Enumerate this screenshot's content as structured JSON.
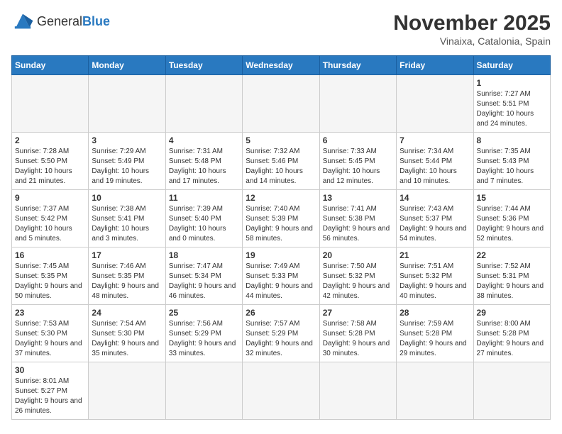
{
  "header": {
    "logo_general": "General",
    "logo_blue": "Blue",
    "title": "November 2025",
    "location": "Vinaixa, Catalonia, Spain"
  },
  "days_of_week": [
    "Sunday",
    "Monday",
    "Tuesday",
    "Wednesday",
    "Thursday",
    "Friday",
    "Saturday"
  ],
  "weeks": [
    [
      {
        "day": "",
        "info": "",
        "empty": true
      },
      {
        "day": "",
        "info": "",
        "empty": true
      },
      {
        "day": "",
        "info": "",
        "empty": true
      },
      {
        "day": "",
        "info": "",
        "empty": true
      },
      {
        "day": "",
        "info": "",
        "empty": true
      },
      {
        "day": "",
        "info": "",
        "empty": true
      },
      {
        "day": "1",
        "info": "Sunrise: 7:27 AM\nSunset: 5:51 PM\nDaylight: 10 hours and 24 minutes."
      }
    ],
    [
      {
        "day": "2",
        "info": "Sunrise: 7:28 AM\nSunset: 5:50 PM\nDaylight: 10 hours and 21 minutes."
      },
      {
        "day": "3",
        "info": "Sunrise: 7:29 AM\nSunset: 5:49 PM\nDaylight: 10 hours and 19 minutes."
      },
      {
        "day": "4",
        "info": "Sunrise: 7:31 AM\nSunset: 5:48 PM\nDaylight: 10 hours and 17 minutes."
      },
      {
        "day": "5",
        "info": "Sunrise: 7:32 AM\nSunset: 5:46 PM\nDaylight: 10 hours and 14 minutes."
      },
      {
        "day": "6",
        "info": "Sunrise: 7:33 AM\nSunset: 5:45 PM\nDaylight: 10 hours and 12 minutes."
      },
      {
        "day": "7",
        "info": "Sunrise: 7:34 AM\nSunset: 5:44 PM\nDaylight: 10 hours and 10 minutes."
      },
      {
        "day": "8",
        "info": "Sunrise: 7:35 AM\nSunset: 5:43 PM\nDaylight: 10 hours and 7 minutes."
      }
    ],
    [
      {
        "day": "9",
        "info": "Sunrise: 7:37 AM\nSunset: 5:42 PM\nDaylight: 10 hours and 5 minutes."
      },
      {
        "day": "10",
        "info": "Sunrise: 7:38 AM\nSunset: 5:41 PM\nDaylight: 10 hours and 3 minutes."
      },
      {
        "day": "11",
        "info": "Sunrise: 7:39 AM\nSunset: 5:40 PM\nDaylight: 10 hours and 0 minutes."
      },
      {
        "day": "12",
        "info": "Sunrise: 7:40 AM\nSunset: 5:39 PM\nDaylight: 9 hours and 58 minutes."
      },
      {
        "day": "13",
        "info": "Sunrise: 7:41 AM\nSunset: 5:38 PM\nDaylight: 9 hours and 56 minutes."
      },
      {
        "day": "14",
        "info": "Sunrise: 7:43 AM\nSunset: 5:37 PM\nDaylight: 9 hours and 54 minutes."
      },
      {
        "day": "15",
        "info": "Sunrise: 7:44 AM\nSunset: 5:36 PM\nDaylight: 9 hours and 52 minutes."
      }
    ],
    [
      {
        "day": "16",
        "info": "Sunrise: 7:45 AM\nSunset: 5:35 PM\nDaylight: 9 hours and 50 minutes."
      },
      {
        "day": "17",
        "info": "Sunrise: 7:46 AM\nSunset: 5:35 PM\nDaylight: 9 hours and 48 minutes."
      },
      {
        "day": "18",
        "info": "Sunrise: 7:47 AM\nSunset: 5:34 PM\nDaylight: 9 hours and 46 minutes."
      },
      {
        "day": "19",
        "info": "Sunrise: 7:49 AM\nSunset: 5:33 PM\nDaylight: 9 hours and 44 minutes."
      },
      {
        "day": "20",
        "info": "Sunrise: 7:50 AM\nSunset: 5:32 PM\nDaylight: 9 hours and 42 minutes."
      },
      {
        "day": "21",
        "info": "Sunrise: 7:51 AM\nSunset: 5:32 PM\nDaylight: 9 hours and 40 minutes."
      },
      {
        "day": "22",
        "info": "Sunrise: 7:52 AM\nSunset: 5:31 PM\nDaylight: 9 hours and 38 minutes."
      }
    ],
    [
      {
        "day": "23",
        "info": "Sunrise: 7:53 AM\nSunset: 5:30 PM\nDaylight: 9 hours and 37 minutes."
      },
      {
        "day": "24",
        "info": "Sunrise: 7:54 AM\nSunset: 5:30 PM\nDaylight: 9 hours and 35 minutes."
      },
      {
        "day": "25",
        "info": "Sunrise: 7:56 AM\nSunset: 5:29 PM\nDaylight: 9 hours and 33 minutes."
      },
      {
        "day": "26",
        "info": "Sunrise: 7:57 AM\nSunset: 5:29 PM\nDaylight: 9 hours and 32 minutes."
      },
      {
        "day": "27",
        "info": "Sunrise: 7:58 AM\nSunset: 5:28 PM\nDaylight: 9 hours and 30 minutes."
      },
      {
        "day": "28",
        "info": "Sunrise: 7:59 AM\nSunset: 5:28 PM\nDaylight: 9 hours and 29 minutes."
      },
      {
        "day": "29",
        "info": "Sunrise: 8:00 AM\nSunset: 5:28 PM\nDaylight: 9 hours and 27 minutes."
      }
    ],
    [
      {
        "day": "30",
        "info": "Sunrise: 8:01 AM\nSunset: 5:27 PM\nDaylight: 9 hours and 26 minutes."
      },
      {
        "day": "",
        "info": "",
        "empty": true
      },
      {
        "day": "",
        "info": "",
        "empty": true
      },
      {
        "day": "",
        "info": "",
        "empty": true
      },
      {
        "day": "",
        "info": "",
        "empty": true
      },
      {
        "day": "",
        "info": "",
        "empty": true
      },
      {
        "day": "",
        "info": "",
        "empty": true
      }
    ]
  ]
}
